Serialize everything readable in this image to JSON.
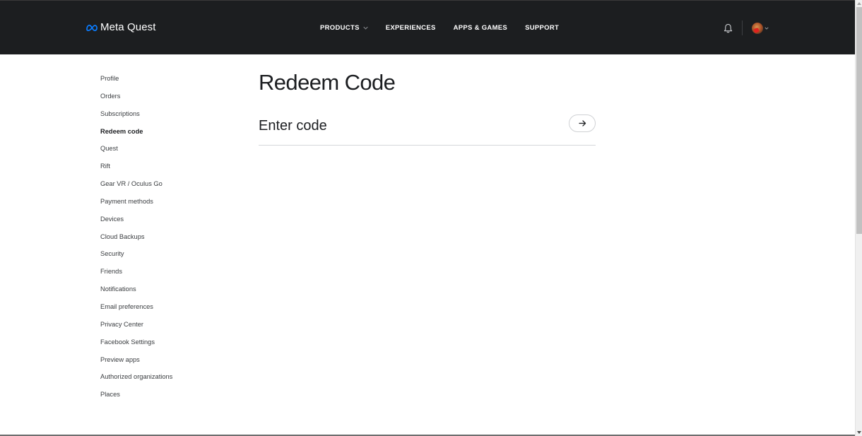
{
  "header": {
    "brand": "Meta Quest",
    "nav": [
      {
        "label": "PRODUCTS",
        "has_dropdown": true
      },
      {
        "label": "EXPERIENCES",
        "has_dropdown": false
      },
      {
        "label": "APPS & GAMES",
        "has_dropdown": false
      },
      {
        "label": "SUPPORT",
        "has_dropdown": false
      }
    ],
    "icons": {
      "notifications": "bell-icon",
      "account": "avatar",
      "account_menu": "chevron-down-icon"
    }
  },
  "sidebar": {
    "active": "Redeem code",
    "items": [
      {
        "label": "Profile"
      },
      {
        "label": "Orders"
      },
      {
        "label": "Subscriptions"
      },
      {
        "label": "Redeem code"
      },
      {
        "label": "Quest"
      },
      {
        "label": "Rift"
      },
      {
        "label": "Gear VR / Oculus Go"
      },
      {
        "label": "Payment methods"
      },
      {
        "label": "Devices"
      },
      {
        "label": "Cloud Backups"
      },
      {
        "label": "Security"
      },
      {
        "label": "Friends"
      },
      {
        "label": "Notifications"
      },
      {
        "label": "Email preferences"
      },
      {
        "label": "Privacy Center"
      },
      {
        "label": "Facebook Settings"
      },
      {
        "label": "Preview apps"
      },
      {
        "label": "Authorized organizations"
      },
      {
        "label": "Places"
      }
    ]
  },
  "main": {
    "title": "Redeem Code",
    "code_input": {
      "value": "",
      "placeholder": "Enter code"
    },
    "submit_icon": "arrow-right-icon"
  },
  "colors": {
    "header_bg": "#1c1e20",
    "brand_blue": "#0866ff",
    "text_primary": "#1c1e21"
  }
}
